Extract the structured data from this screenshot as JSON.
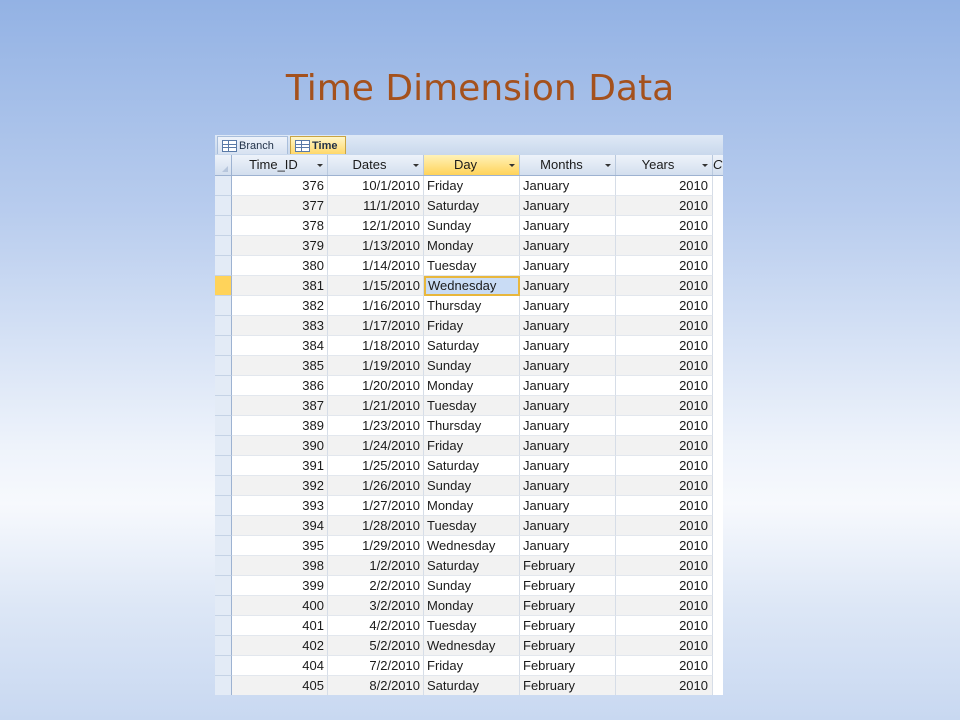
{
  "slide": {
    "title": "Time Dimension Data"
  },
  "tabs": [
    {
      "label": "Branch",
      "active": false
    },
    {
      "label": "Time",
      "active": true
    }
  ],
  "columns": [
    "Time_ID",
    "Dates",
    "Day",
    "Months",
    "Years"
  ],
  "clipped_column": "C",
  "selected": {
    "row": 5,
    "column": "Day"
  },
  "rows": [
    {
      "time_id": "376",
      "date": "10/1/2010",
      "day": "Friday",
      "month": "January",
      "year": "2010"
    },
    {
      "time_id": "377",
      "date": "11/1/2010",
      "day": "Saturday",
      "month": "January",
      "year": "2010"
    },
    {
      "time_id": "378",
      "date": "12/1/2010",
      "day": "Sunday",
      "month": "January",
      "year": "2010"
    },
    {
      "time_id": "379",
      "date": "1/13/2010",
      "day": "Monday",
      "month": "January",
      "year": "2010"
    },
    {
      "time_id": "380",
      "date": "1/14/2010",
      "day": "Tuesday",
      "month": "January",
      "year": "2010"
    },
    {
      "time_id": "381",
      "date": "1/15/2010",
      "day": "Wednesday",
      "month": "January",
      "year": "2010"
    },
    {
      "time_id": "382",
      "date": "1/16/2010",
      "day": "Thursday",
      "month": "January",
      "year": "2010"
    },
    {
      "time_id": "383",
      "date": "1/17/2010",
      "day": "Friday",
      "month": "January",
      "year": "2010"
    },
    {
      "time_id": "384",
      "date": "1/18/2010",
      "day": "Saturday",
      "month": "January",
      "year": "2010"
    },
    {
      "time_id": "385",
      "date": "1/19/2010",
      "day": "Sunday",
      "month": "January",
      "year": "2010"
    },
    {
      "time_id": "386",
      "date": "1/20/2010",
      "day": "Monday",
      "month": "January",
      "year": "2010"
    },
    {
      "time_id": "387",
      "date": "1/21/2010",
      "day": "Tuesday",
      "month": "January",
      "year": "2010"
    },
    {
      "time_id": "389",
      "date": "1/23/2010",
      "day": "Thursday",
      "month": "January",
      "year": "2010"
    },
    {
      "time_id": "390",
      "date": "1/24/2010",
      "day": "Friday",
      "month": "January",
      "year": "2010"
    },
    {
      "time_id": "391",
      "date": "1/25/2010",
      "day": "Saturday",
      "month": "January",
      "year": "2010"
    },
    {
      "time_id": "392",
      "date": "1/26/2010",
      "day": "Sunday",
      "month": "January",
      "year": "2010"
    },
    {
      "time_id": "393",
      "date": "1/27/2010",
      "day": "Monday",
      "month": "January",
      "year": "2010"
    },
    {
      "time_id": "394",
      "date": "1/28/2010",
      "day": "Tuesday",
      "month": "January",
      "year": "2010"
    },
    {
      "time_id": "395",
      "date": "1/29/2010",
      "day": "Wednesday",
      "month": "January",
      "year": "2010"
    },
    {
      "time_id": "398",
      "date": "1/2/2010",
      "day": "Saturday",
      "month": "February",
      "year": "2010"
    },
    {
      "time_id": "399",
      "date": "2/2/2010",
      "day": "Sunday",
      "month": "February",
      "year": "2010"
    },
    {
      "time_id": "400",
      "date": "3/2/2010",
      "day": "Monday",
      "month": "February",
      "year": "2010"
    },
    {
      "time_id": "401",
      "date": "4/2/2010",
      "day": "Tuesday",
      "month": "February",
      "year": "2010"
    },
    {
      "time_id": "402",
      "date": "5/2/2010",
      "day": "Wednesday",
      "month": "February",
      "year": "2010"
    },
    {
      "time_id": "404",
      "date": "7/2/2010",
      "day": "Friday",
      "month": "February",
      "year": "2010"
    },
    {
      "time_id": "405",
      "date": "8/2/2010",
      "day": "Saturday",
      "month": "February",
      "year": "2010"
    }
  ]
}
